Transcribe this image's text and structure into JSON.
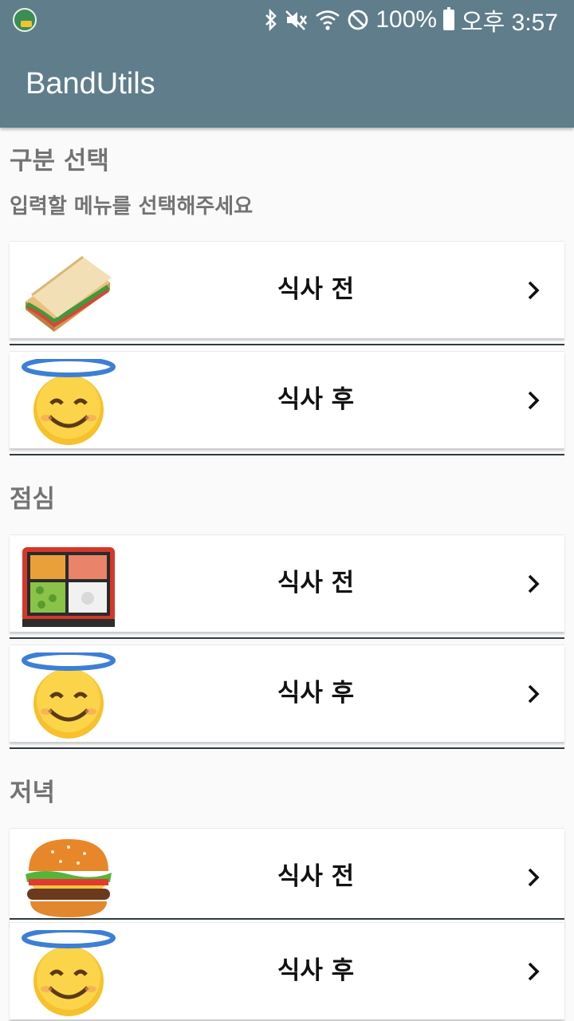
{
  "status_bar": {
    "battery": "100%",
    "time": "오후 3:57",
    "icons": [
      "app-notification-icon",
      "bluetooth-icon",
      "mute-icon",
      "wifi-icon",
      "do-not-disturb-icon",
      "battery-icon"
    ]
  },
  "app_bar": {
    "title": "BandUtils"
  },
  "header": {
    "title": "구분 선택",
    "subtitle": "입력할 메뉴를 선택해주세요"
  },
  "sections": [
    {
      "title": "",
      "items": [
        {
          "label": "식사 전",
          "icon": "sandwich-icon"
        },
        {
          "label": "식사 후",
          "icon": "halo-smile-icon"
        }
      ]
    },
    {
      "title": "점심",
      "items": [
        {
          "label": "식사 전",
          "icon": "bento-box-icon"
        },
        {
          "label": "식사 후",
          "icon": "halo-smile-icon"
        }
      ]
    },
    {
      "title": "저녁",
      "items": [
        {
          "label": "식사 전",
          "icon": "hamburger-icon"
        },
        {
          "label": "식사 후",
          "icon": "halo-smile-icon"
        }
      ]
    }
  ],
  "colors": {
    "app_bar": "#607d8b",
    "background": "#fafafa",
    "section_text": "#737373"
  }
}
